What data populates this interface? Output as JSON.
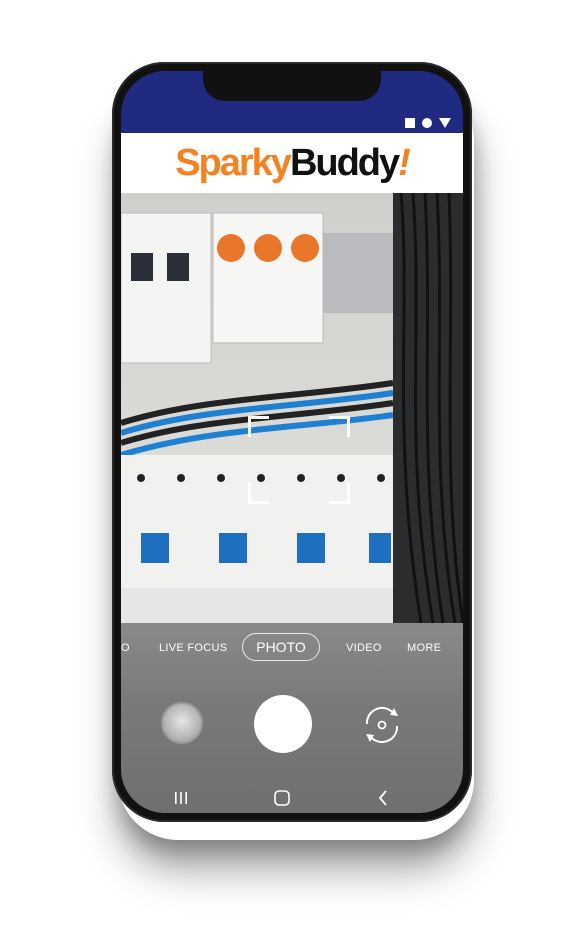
{
  "status_bar": {
    "icons": [
      "stop-square-icon",
      "record-circle-icon",
      "signal-triangle-icon"
    ]
  },
  "app": {
    "logo_sparky": "Sparky",
    "logo_buddy": "Buddy",
    "logo_bang": "!",
    "brand_color": "#f58220",
    "header_color": "#1f2a80"
  },
  "camera": {
    "modes": [
      "O",
      "LIVE FOCUS",
      "PHOTO",
      "VIDEO",
      "MORE"
    ],
    "selected_mode": "PHOTO"
  },
  "controls": {
    "gallery_icon": "gallery-thumbnail",
    "shutter_icon": "shutter-button",
    "switch_icon": "switch-camera-icon"
  },
  "navigation": {
    "icons": [
      "recent-apps-icon",
      "home-icon",
      "back-icon"
    ]
  }
}
